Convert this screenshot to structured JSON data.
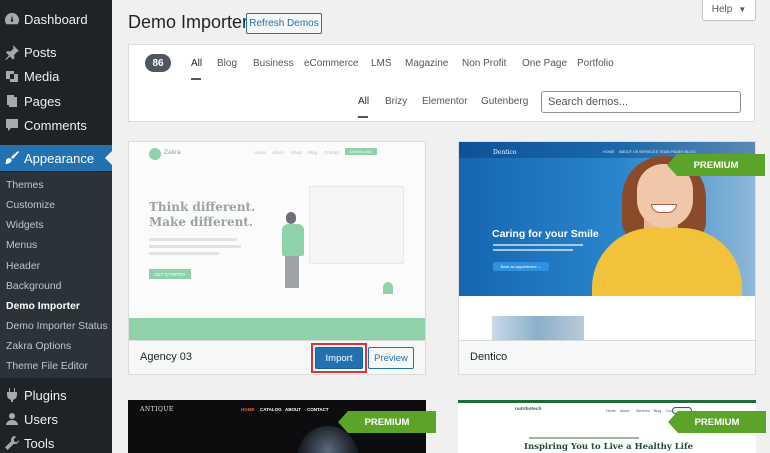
{
  "sidebar": {
    "top_items": [
      {
        "label": "Dashboard",
        "icon": "dashboard-icon"
      },
      {
        "label": "Posts",
        "icon": "pin-icon"
      },
      {
        "label": "Media",
        "icon": "media-icon"
      },
      {
        "label": "Pages",
        "icon": "pages-icon"
      },
      {
        "label": "Comments",
        "icon": "comment-icon"
      }
    ],
    "active": {
      "label": "Appearance",
      "icon": "brush-icon"
    },
    "submenu": [
      "Themes",
      "Customize",
      "Widgets",
      "Menus",
      "Header",
      "Background",
      "Demo Importer",
      "Demo Importer Status",
      "Zakra Options",
      "Theme File Editor"
    ],
    "submenu_current": "Demo Importer",
    "bottom_items": [
      {
        "label": "Plugins",
        "icon": "plugin-icon"
      },
      {
        "label": "Users",
        "icon": "users-icon"
      },
      {
        "label": "Tools",
        "icon": "tools-icon"
      }
    ]
  },
  "header": {
    "title": "Demo Importer",
    "refresh_label": "Refresh Demos",
    "help_label": "Help"
  },
  "filters": {
    "count": "86",
    "categories": [
      "All",
      "Blog",
      "Business",
      "eCommerce",
      "LMS",
      "Magazine",
      "Non Profit",
      "One Page",
      "Portfolio"
    ],
    "active_category": "All",
    "builders": [
      "All",
      "Brizy",
      "Elementor",
      "Gutenberg"
    ],
    "active_builder": "All",
    "search_placeholder": "Search demos..."
  },
  "cards": {
    "agency": {
      "name": "Agency 03",
      "import_label": "Import",
      "preview_label": "Preview",
      "thumb": {
        "logo": "Zakra",
        "nav": [
          "Home",
          "About",
          "Shop",
          "Blog",
          "Contact"
        ],
        "download": "DOWNLOAD",
        "headline_1": "Think different.",
        "headline_2": "Make different.",
        "cta": "GET STARTED"
      }
    },
    "dentico": {
      "name": "Dentico",
      "badge": "PREMIUM",
      "thumb": {
        "logo": "Dentico",
        "nav": [
          "HOME",
          "ABOUT US",
          "SERVICES",
          "TEAM",
          "PAGES",
          "BLOG"
        ],
        "headline": "Caring for your Smile",
        "cta": "Book an appointment →"
      }
    },
    "antique": {
      "badge": "PREMIUM",
      "thumb": {
        "logo": "ANTIQUE",
        "nav": [
          "HOME",
          "CATALOG",
          "ABOUT",
          "CONTACT"
        ]
      }
    },
    "nutri": {
      "badge": "PREMIUM",
      "thumb": {
        "logo": "nutritiotech",
        "nav": [
          "Home",
          "About",
          "Services",
          "Blog",
          "Contact"
        ],
        "headline": "Inspiring You to Live a Healthy Life"
      }
    }
  },
  "colors": {
    "admin_sidebar": "#1d2327",
    "accent": "#2271b1",
    "premium": "#5ca32a",
    "highlight": "#d63638"
  }
}
